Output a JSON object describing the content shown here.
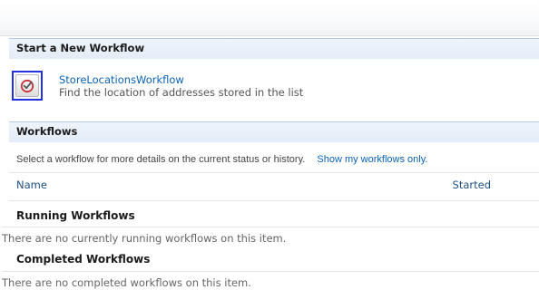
{
  "start_section": {
    "title": "Start a New Workflow",
    "workflow": {
      "icon": "workflow-check-icon",
      "name": "StoreLocationsWorkflow",
      "description": "Find the location of addresses stored in the list"
    }
  },
  "workflows_section": {
    "title": "Workflows",
    "instruction": "Select a workflow for more details on the current status or history.",
    "filter_link": "Show my workflows only.",
    "columns": {
      "name": "Name",
      "started": "Started"
    },
    "running": {
      "title": "Running Workflows",
      "empty_message": "There are no currently running workflows on this item."
    },
    "completed": {
      "title": "Completed Workflows",
      "empty_message": "There are no completed workflows on this item."
    }
  },
  "colors": {
    "link": "#0a62b8",
    "header_bg": "#e3ecf7",
    "focus_border": "#2233dd"
  }
}
